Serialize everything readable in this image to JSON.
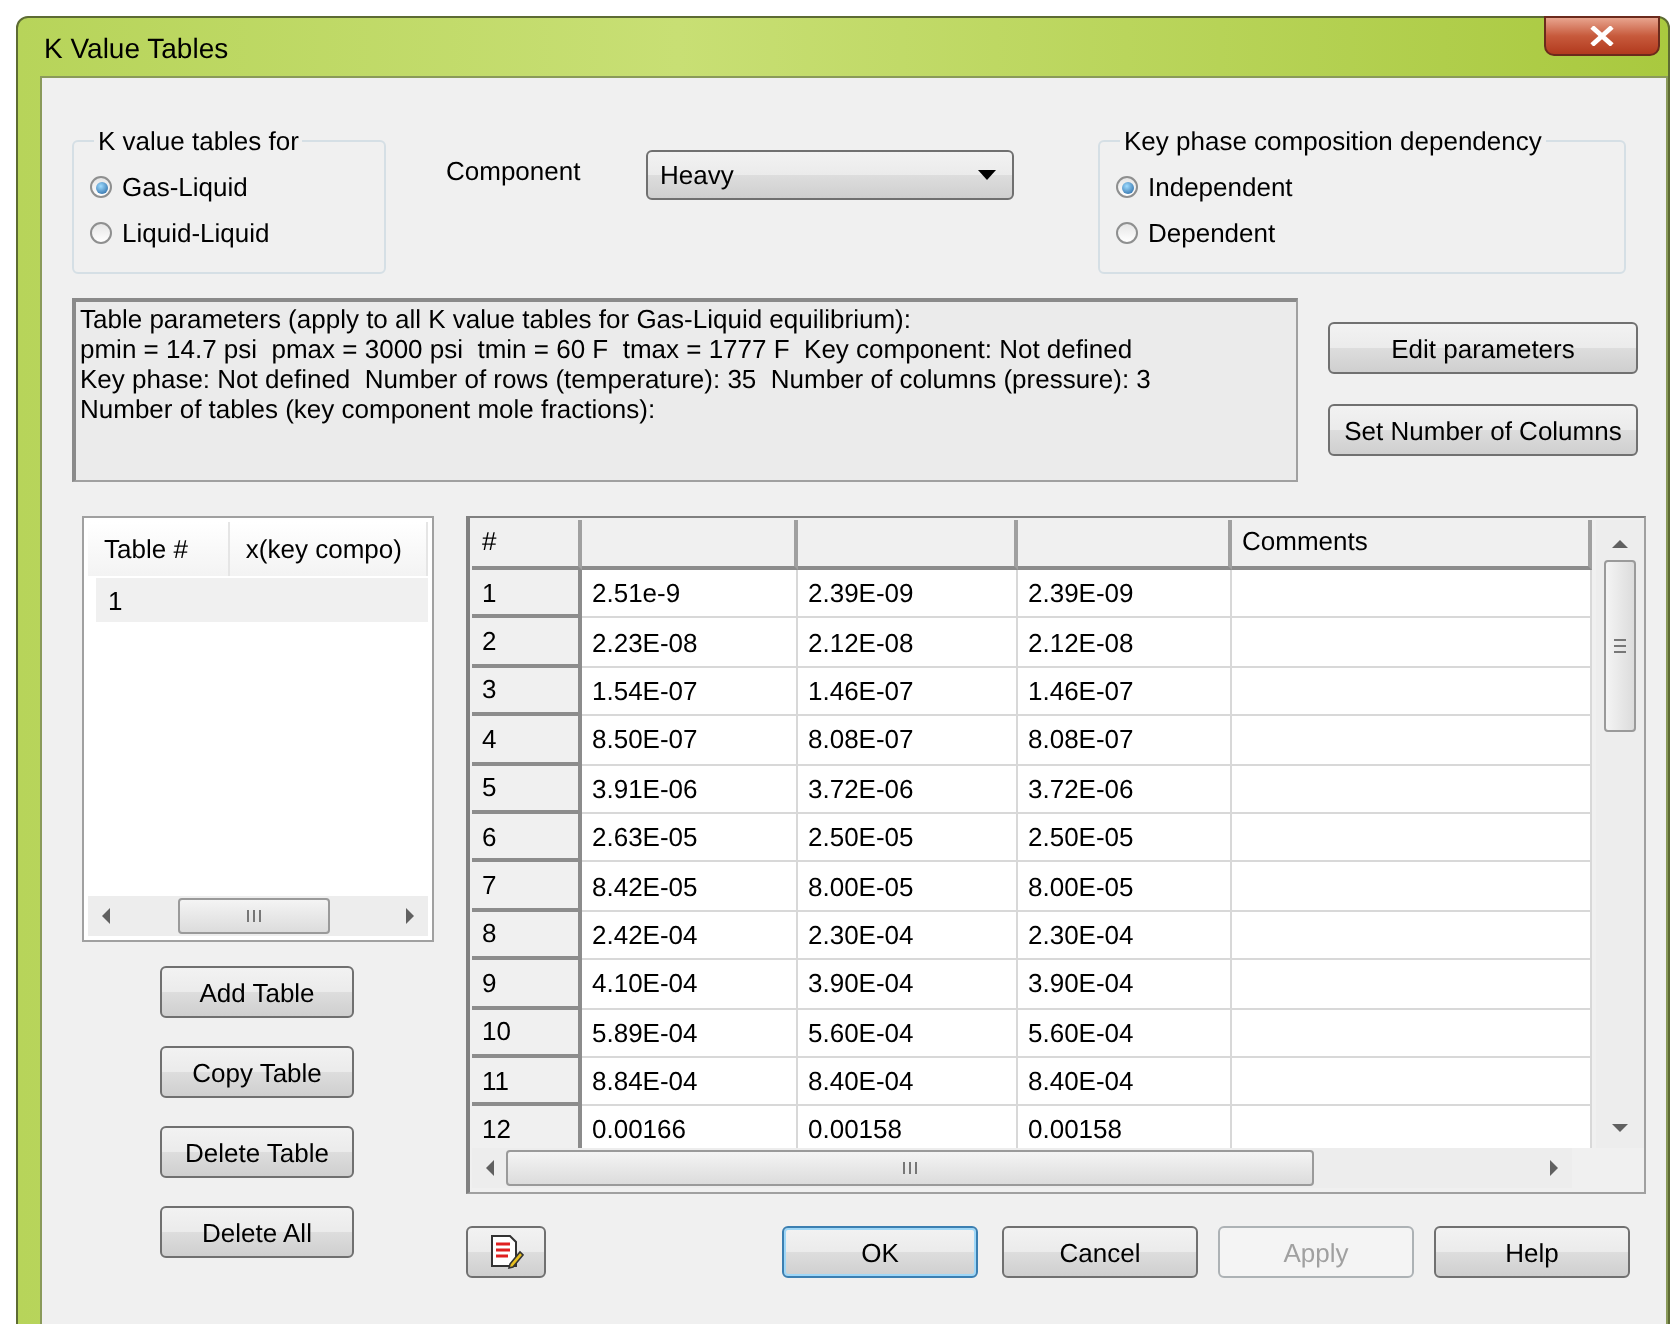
{
  "window": {
    "title": "K Value Tables"
  },
  "table_type": {
    "label": "K value tables for",
    "options": [
      {
        "label": "Gas-Liquid",
        "selected": true
      },
      {
        "label": "Liquid-Liquid",
        "selected": false
      }
    ]
  },
  "component": {
    "label": "Component",
    "value": "Heavy"
  },
  "dependency": {
    "label": "Key phase composition dependency",
    "options": [
      {
        "label": "Independent",
        "selected": true
      },
      {
        "label": "Dependent",
        "selected": false
      }
    ]
  },
  "parameters_text": [
    "Table parameters (apply to all K value tables for Gas-Liquid equilibrium):",
    "pmin = 14.7 psi  pmax = 3000 psi  tmin = 60 F  tmax = 1777 F  Key component: Not defined",
    "Key phase: Not defined  Number of rows (temperature): 35  Number of columns (pressure): 3",
    "Number of tables (key component mole fractions):"
  ],
  "parameter_buttons": [
    "Edit parameters",
    "Set Number of Columns"
  ],
  "table_list": {
    "columns": [
      "Table #",
      "x(key compo)"
    ],
    "rows": [
      {
        "cells": [
          "1"
        ],
        "selected": true
      }
    ]
  },
  "table_buttons": [
    "Add Table",
    "Copy Table",
    "Delete Table",
    "Delete All"
  ],
  "grid": {
    "columns": [
      {
        "kind": "number",
        "label": "#"
      },
      {
        "kind": "value"
      },
      {
        "kind": "value"
      },
      {
        "kind": "value"
      },
      {
        "kind": "comment",
        "label": "Comments"
      }
    ],
    "rows": [
      [
        "1",
        "2.51e-9",
        "2.39E-09",
        "2.39E-09"
      ],
      [
        "2",
        "2.23E-08",
        "2.12E-08",
        "2.12E-08"
      ],
      [
        "3",
        "1.54E-07",
        "1.46E-07",
        "1.46E-07"
      ],
      [
        "4",
        "8.50E-07",
        "8.08E-07",
        "8.08E-07"
      ],
      [
        "5",
        "3.91E-06",
        "3.72E-06",
        "3.72E-06"
      ],
      [
        "6",
        "2.63E-05",
        "2.50E-05",
        "2.50E-05"
      ],
      [
        "7",
        "8.42E-05",
        "8.00E-05",
        "8.00E-05"
      ],
      [
        "8",
        "2.42E-04",
        "2.30E-04",
        "2.30E-04"
      ],
      [
        "9",
        "4.10E-04",
        "3.90E-04",
        "3.90E-04"
      ],
      [
        "10",
        "5.89E-04",
        "5.60E-04",
        "5.60E-04"
      ],
      [
        "11",
        "8.84E-04",
        "8.40E-04",
        "8.40E-04"
      ],
      [
        "12",
        "0.00166",
        "0.00158",
        "0.00158"
      ]
    ]
  },
  "buttons": [
    {
      "label": "OK",
      "default": true,
      "disabled": false
    },
    {
      "label": "Cancel",
      "default": false,
      "disabled": false
    },
    {
      "label": "Apply",
      "default": false,
      "disabled": true
    },
    {
      "label": "Help",
      "default": false,
      "disabled": false
    }
  ]
}
